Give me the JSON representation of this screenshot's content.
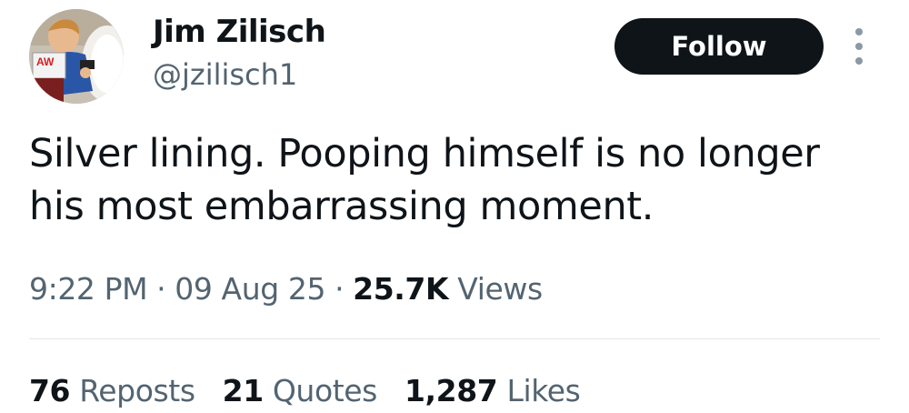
{
  "author": {
    "display_name": "Jim Zilisch",
    "handle": "@jzilisch1",
    "avatar_sign_text": "AW"
  },
  "actions": {
    "follow_label": "Follow",
    "more_icon": "more-vertical-icon"
  },
  "tweet": {
    "text": "Silver lining.  Pooping himself is no longer his most embarrassing moment."
  },
  "meta": {
    "time": "9:22 PM",
    "separator": "·",
    "date": "09 Aug 25",
    "views_count": "25.7K",
    "views_label": "Views"
  },
  "stats": {
    "reposts_count": "76",
    "reposts_label": "Reposts",
    "quotes_count": "21",
    "quotes_label": "Quotes",
    "likes_count": "1,287",
    "likes_label": "Likes"
  },
  "colors": {
    "text_primary": "#0f1419",
    "text_secondary": "#536471",
    "follow_bg": "#0f1419",
    "divider": "#e1e6ea"
  }
}
